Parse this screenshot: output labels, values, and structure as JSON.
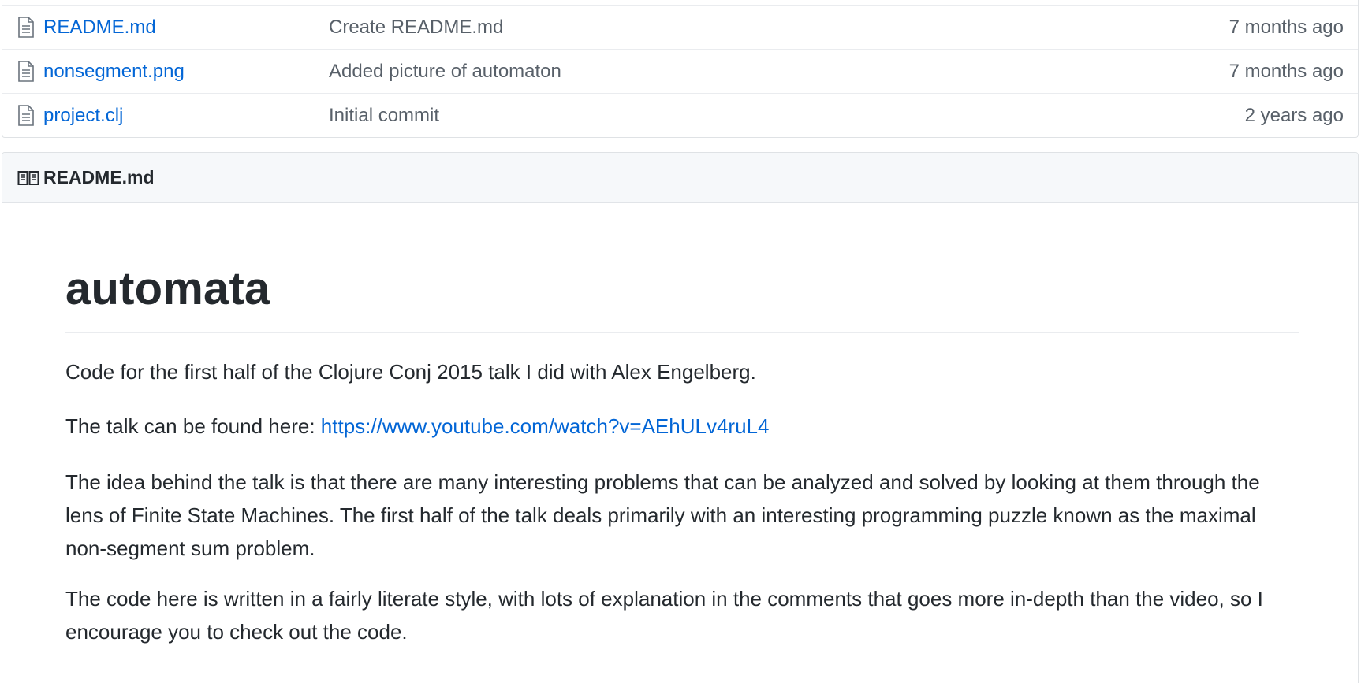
{
  "files": [
    {
      "name": "README.md",
      "message": "Create README.md",
      "age": "7 months ago",
      "icon": "file-text-icon"
    },
    {
      "name": "nonsegment.png",
      "message": "Added picture of automaton",
      "age": "7 months ago",
      "icon": "file-text-icon"
    },
    {
      "name": "project.clj",
      "message": "Initial commit",
      "age": "2 years ago",
      "icon": "file-text-icon"
    }
  ],
  "readme": {
    "header_title": "README.md",
    "header_icon": "book-icon",
    "h1": "automata",
    "p1": "Code for the first half of the Clojure Conj 2015 talk I did with Alex Engelberg.",
    "p2_prefix": "The talk can be found here: ",
    "p2_link": "https://www.youtube.com/watch?v=AEhULv4ruL4",
    "p3": "The idea behind the talk is that there are many interesting problems that can be analyzed and solved by looking at them through the lens of Finite State Machines. The first half of the talk deals primarily with an interesting programming puzzle known as the maximal non-segment sum problem.",
    "p4": "The code here is written in a fairly literate style, with lots of explanation in the comments that goes more in-depth than the video, so I encourage you to check out the code."
  },
  "colors": {
    "link": "#0366d6",
    "muted": "#586069",
    "text": "#24292e",
    "header_bg": "#f6f8fa",
    "border": "#dfe2e5"
  }
}
